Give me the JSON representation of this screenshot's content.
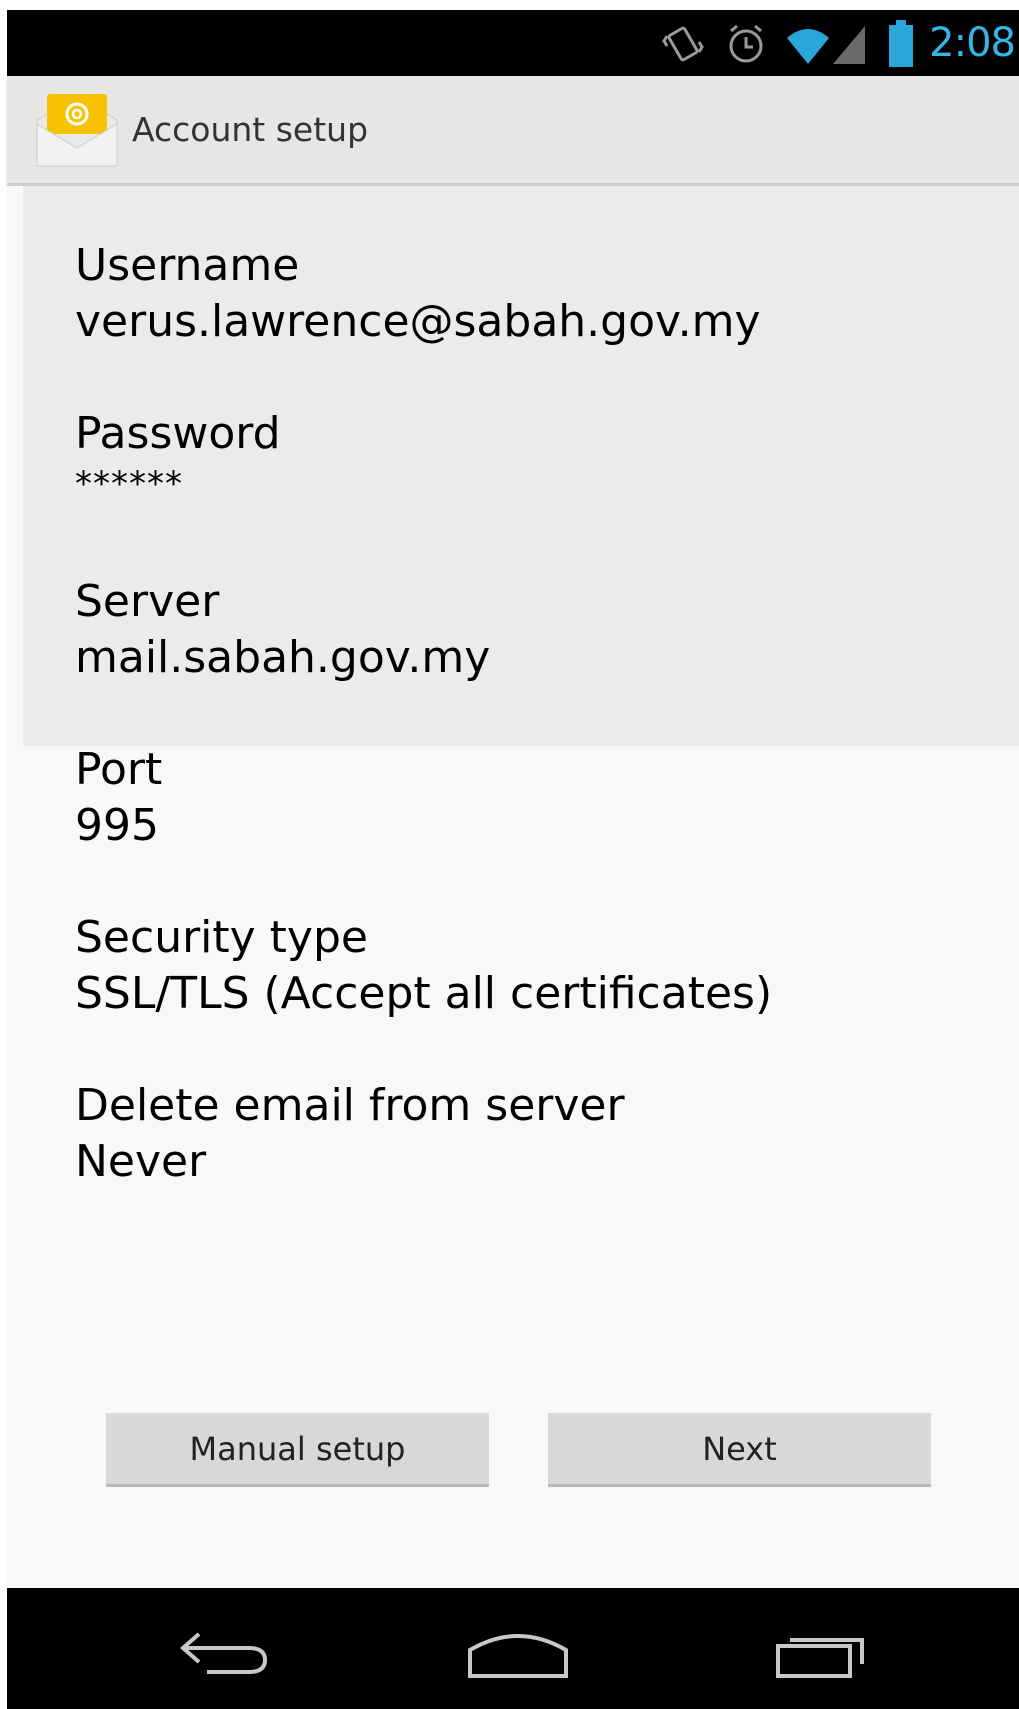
{
  "status_bar": {
    "time": "2:08",
    "icons": [
      "vibrate-icon",
      "alarm-icon",
      "wifi-icon",
      "signal-icon",
      "battery-icon"
    ],
    "accent_color": "#33b5e5"
  },
  "action_bar": {
    "title": "Account setup",
    "icon": "email-app-icon"
  },
  "fields": [
    {
      "label": "Username",
      "value": "verus.lawrence@sabah.gov.my"
    },
    {
      "label": "Password",
      "value": "******"
    },
    {
      "label": "Server",
      "value": "mail.sabah.gov.my"
    },
    {
      "label": "Port",
      "value": "995"
    },
    {
      "label": "Security type",
      "value": "SSL/TLS (Accept all certificates)"
    },
    {
      "label": "Delete email from server",
      "value": "Never"
    }
  ],
  "buttons": {
    "manual_setup": "Manual setup",
    "next": "Next"
  },
  "nav_bar": {
    "icons": [
      "back-icon",
      "home-icon",
      "recent-apps-icon"
    ]
  }
}
